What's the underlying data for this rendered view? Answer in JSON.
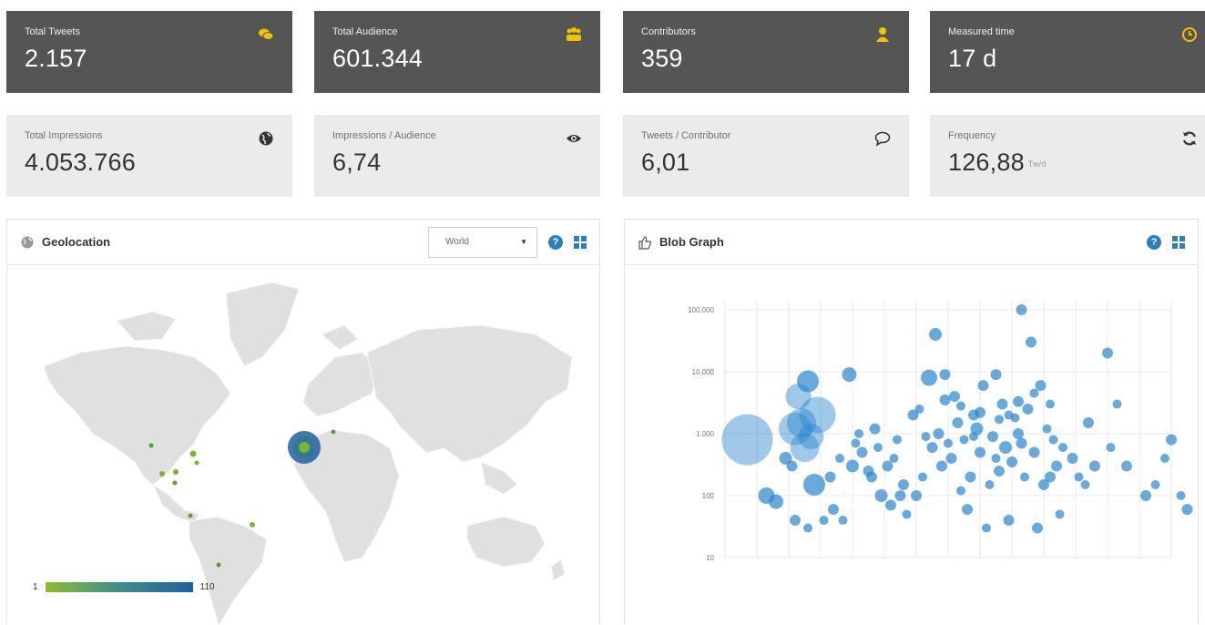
{
  "stats_top": [
    {
      "label": "Total Tweets",
      "value": "2.157",
      "icon": "chat-bubbles-icon"
    },
    {
      "label": "Total Audience",
      "value": "601.344",
      "icon": "users-group-icon"
    },
    {
      "label": "Contributors",
      "value": "359",
      "icon": "user-icon"
    },
    {
      "label": "Measured time",
      "value": "17 d",
      "icon": "clock-icon"
    }
  ],
  "stats_bottom": [
    {
      "label": "Total Impressions",
      "value": "4.053.766",
      "icon": "globe-icon"
    },
    {
      "label": "Impressions / Audience",
      "value": "6,74",
      "icon": "eye-icon"
    },
    {
      "label": "Tweets / Contributor",
      "value": "6,01",
      "icon": "speech-bubble-icon"
    },
    {
      "label": "Frequency",
      "value": "126,88",
      "unit": "Tw/d",
      "icon": "refresh-icon"
    }
  ],
  "geolocation": {
    "title": "Geolocation",
    "region_select": "World",
    "legend_min": "1",
    "legend_max": "110"
  },
  "blob_graph": {
    "title": "Blob Graph"
  },
  "chart_data": {
    "type": "scatter",
    "title": "",
    "xlabel": "",
    "ylabel": "",
    "y_scale": "log",
    "ylim": [
      10,
      100000
    ],
    "y_ticks": [
      "100.000",
      "10.000",
      "1.000",
      "100",
      "10"
    ],
    "x_ticks": [
      "",
      "",
      "",
      "",
      "",
      "",
      "",
      "",
      "",
      "",
      "",
      "",
      "",
      "",
      ""
    ],
    "series": [
      {
        "points": [
          [
            0.7,
            800,
            28
          ],
          [
            2.3,
            4000,
            14
          ],
          [
            2.5,
            600,
            16
          ],
          [
            2.6,
            7000,
            12
          ],
          [
            2.9,
            2000,
            20
          ],
          [
            2.8,
            150,
            12
          ],
          [
            1.3,
            100,
            9
          ],
          [
            1.6,
            80,
            8
          ],
          [
            1.9,
            400,
            7
          ],
          [
            2.1,
            300,
            6
          ],
          [
            2.2,
            1200,
            18
          ],
          [
            2.4,
            1500,
            16
          ],
          [
            2.7,
            900,
            14
          ],
          [
            2.2,
            40,
            6
          ],
          [
            2.6,
            30,
            5
          ],
          [
            3.1,
            40,
            5
          ],
          [
            3.4,
            60,
            6
          ],
          [
            3.7,
            40,
            5
          ],
          [
            4.0,
            300,
            7
          ],
          [
            4.3,
            500,
            6
          ],
          [
            4.6,
            200,
            6
          ],
          [
            4.9,
            100,
            7
          ],
          [
            4.2,
            1000,
            5
          ],
          [
            3.9,
            9000,
            8
          ],
          [
            5.2,
            70,
            6
          ],
          [
            5.5,
            100,
            6
          ],
          [
            5.9,
            2000,
            6
          ],
          [
            6.3,
            900,
            5
          ],
          [
            6.4,
            8000,
            9
          ],
          [
            6.6,
            40000,
            7
          ],
          [
            6.9,
            9000,
            6
          ],
          [
            7.2,
            4000,
            6
          ],
          [
            7.5,
            800,
            5
          ],
          [
            7.8,
            2000,
            6
          ],
          [
            8.1,
            6000,
            6
          ],
          [
            8.5,
            9000,
            6
          ],
          [
            8.9,
            2000,
            5
          ],
          [
            9.2,
            1000,
            6
          ],
          [
            9.3,
            100000,
            6
          ],
          [
            9.6,
            30000,
            6
          ],
          [
            9.9,
            6000,
            6
          ],
          [
            10.2,
            3000,
            5
          ],
          [
            10.6,
            600,
            5
          ],
          [
            10.9,
            400,
            6
          ],
          [
            11.3,
            150,
            5
          ],
          [
            11.6,
            300,
            6
          ],
          [
            12.0,
            20000,
            6
          ],
          [
            12.3,
            3000,
            5
          ],
          [
            12.6,
            300,
            6
          ],
          [
            13.2,
            100,
            6
          ],
          [
            13.5,
            150,
            5
          ],
          [
            13.8,
            400,
            5
          ],
          [
            14.0,
            800,
            6
          ],
          [
            14.3,
            100,
            5
          ],
          [
            14.5,
            60,
            6
          ],
          [
            15.1,
            800,
            6
          ],
          [
            6.8,
            300,
            6
          ],
          [
            7.1,
            400,
            6
          ],
          [
            7.4,
            120,
            5
          ],
          [
            7.7,
            200,
            6
          ],
          [
            8.0,
            500,
            6
          ],
          [
            8.3,
            150,
            5
          ],
          [
            8.6,
            250,
            6
          ],
          [
            8.8,
            600,
            7
          ],
          [
            9.0,
            350,
            6
          ],
          [
            9.4,
            200,
            5
          ],
          [
            9.7,
            500,
            6
          ],
          [
            10.0,
            150,
            6
          ],
          [
            10.3,
            800,
            5
          ],
          [
            7.3,
            1500,
            6
          ],
          [
            7.9,
            1200,
            7
          ],
          [
            8.4,
            900,
            6
          ],
          [
            8.7,
            3000,
            6
          ],
          [
            9.1,
            1800,
            5
          ],
          [
            9.5,
            2500,
            6
          ],
          [
            6.5,
            600,
            6
          ],
          [
            6.2,
            200,
            5
          ],
          [
            6.0,
            100,
            6
          ],
          [
            5.7,
            50,
            5
          ],
          [
            7.6,
            60,
            6
          ],
          [
            8.2,
            30,
            5
          ],
          [
            8.9,
            40,
            6
          ],
          [
            9.8,
            30,
            6
          ],
          [
            10.5,
            50,
            5
          ],
          [
            3.3,
            200,
            6
          ],
          [
            3.6,
            400,
            5
          ],
          [
            4.5,
            250,
            6
          ],
          [
            4.8,
            600,
            5
          ],
          [
            5.1,
            300,
            6
          ],
          [
            5.4,
            800,
            5
          ],
          [
            6.7,
            1000,
            6
          ],
          [
            7.0,
            700,
            5
          ],
          [
            7.8,
            900,
            5
          ],
          [
            8.5,
            400,
            5
          ],
          [
            9.3,
            700,
            6
          ],
          [
            10.1,
            1200,
            5
          ],
          [
            10.4,
            300,
            6
          ],
          [
            11.1,
            200,
            5
          ],
          [
            11.4,
            1500,
            6
          ],
          [
            12.1,
            600,
            5
          ],
          [
            6.1,
            2500,
            5
          ],
          [
            6.9,
            3500,
            6
          ],
          [
            7.4,
            2800,
            5
          ],
          [
            8.0,
            2200,
            6
          ],
          [
            8.6,
            1700,
            5
          ],
          [
            9.2,
            3300,
            6
          ],
          [
            9.7,
            4500,
            5
          ],
          [
            10.2,
            200,
            6
          ],
          [
            5.6,
            150,
            6
          ],
          [
            5.3,
            400,
            5
          ],
          [
            4.7,
            1200,
            6
          ],
          [
            4.1,
            700,
            5
          ]
        ]
      }
    ]
  }
}
